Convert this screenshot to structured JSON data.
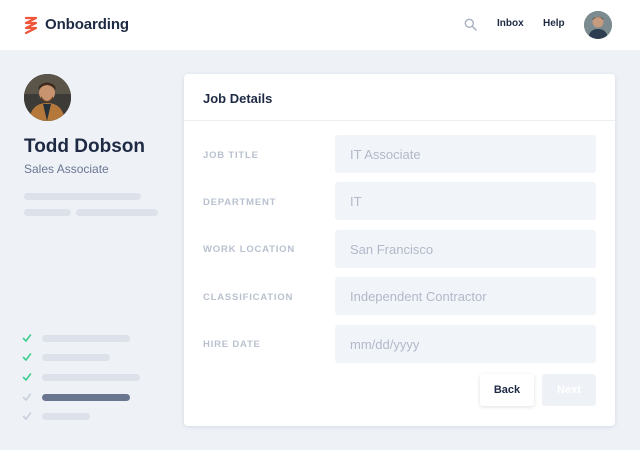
{
  "header": {
    "app_title": "Onboarding",
    "logo_icon": "zigzag-logo-icon",
    "search_icon": "search-icon",
    "nav": {
      "inbox": "Inbox",
      "help": "Help"
    },
    "brand_color": "#f0563a"
  },
  "profile": {
    "name": "Todd Dobson",
    "role": "Sales Associate"
  },
  "steps": [
    {
      "status": "complete"
    },
    {
      "status": "complete"
    },
    {
      "status": "complete"
    },
    {
      "status": "current"
    },
    {
      "status": "pending"
    }
  ],
  "card": {
    "title": "Job Details",
    "fields": [
      {
        "label": "JOB TITLE",
        "value": "IT Associate"
      },
      {
        "label": "DEPARTMENT",
        "value": "IT"
      },
      {
        "label": "WORK LOCATION",
        "value": "San Francisco"
      },
      {
        "label": "CLASSIFICATION",
        "value": "Independent Contractor"
      },
      {
        "label": "HIRE DATE",
        "placeholder": "mm/dd/yyyy"
      }
    ],
    "back_label": "Back",
    "next_label": "Next"
  },
  "colors": {
    "check_complete": "#3ecf8e",
    "check_pending": "#c9d0dc",
    "active_step_bar": "#6a7590"
  }
}
